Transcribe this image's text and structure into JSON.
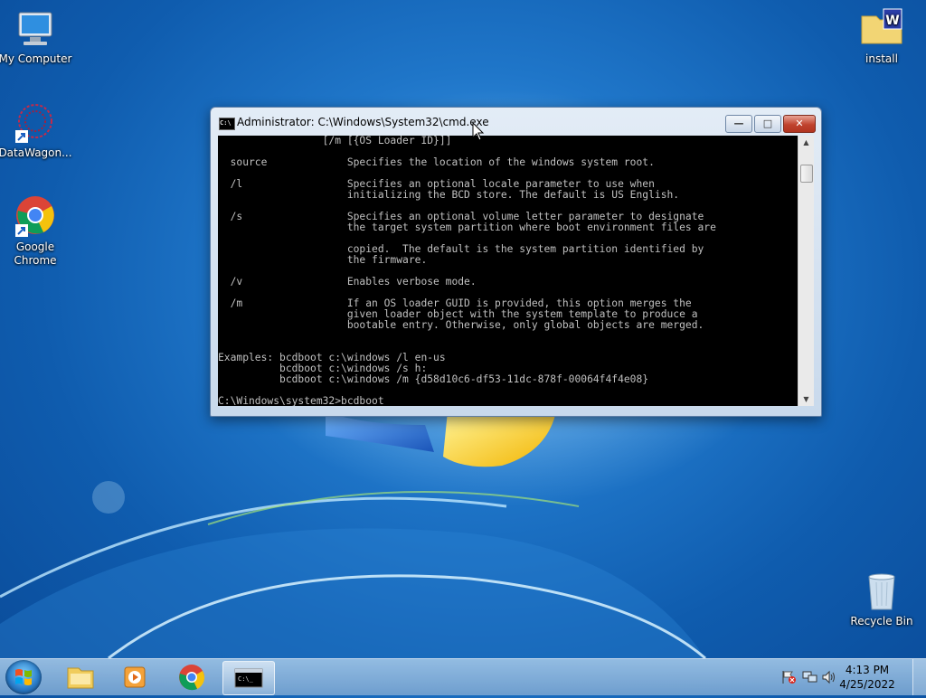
{
  "desktop": {
    "icons": [
      {
        "label": "My Computer"
      },
      {
        "label": "DataWagon..."
      },
      {
        "label": "Google Chrome"
      },
      {
        "label": "install"
      },
      {
        "label": "Recycle Bin"
      }
    ]
  },
  "window": {
    "title": "Administrator: C:\\Windows\\System32\\cmd.exe",
    "buttons": {
      "minimize": "—",
      "maximize": "□",
      "close": "✕"
    },
    "console_lines": [
      "                 [/m [{OS Loader ID}]]",
      "",
      "  source             Specifies the location of the windows system root.",
      "",
      "  /l                 Specifies an optional locale parameter to use when",
      "                     initializing the BCD store. The default is US English.",
      "",
      "  /s                 Specifies an optional volume letter parameter to designate",
      "                     the target system partition where boot environment files are",
      "",
      "                     copied.  The default is the system partition identified by",
      "                     the firmware.",
      "",
      "  /v                 Enables verbose mode.",
      "",
      "  /m                 If an OS loader GUID is provided, this option merges the",
      "                     given loader object with the system template to produce a",
      "                     bootable entry. Otherwise, only global objects are merged.",
      "",
      "",
      "Examples: bcdboot c:\\windows /l en-us",
      "          bcdboot c:\\windows /s h:",
      "          bcdboot c:\\windows /m {d58d10c6-df53-11dc-878f-00064f4f4e08}",
      "",
      "C:\\Windows\\system32>bcdboot _"
    ]
  },
  "taskbar": {
    "pinned": [
      "windows-explorer",
      "media-player",
      "google-chrome",
      "command-prompt"
    ],
    "clock": {
      "time": "4:13 PM",
      "date": "4/25/2022"
    }
  },
  "colors": {
    "console_bg": "#000000",
    "console_fg": "#c0c0c0",
    "close_red": "#c0432e"
  }
}
